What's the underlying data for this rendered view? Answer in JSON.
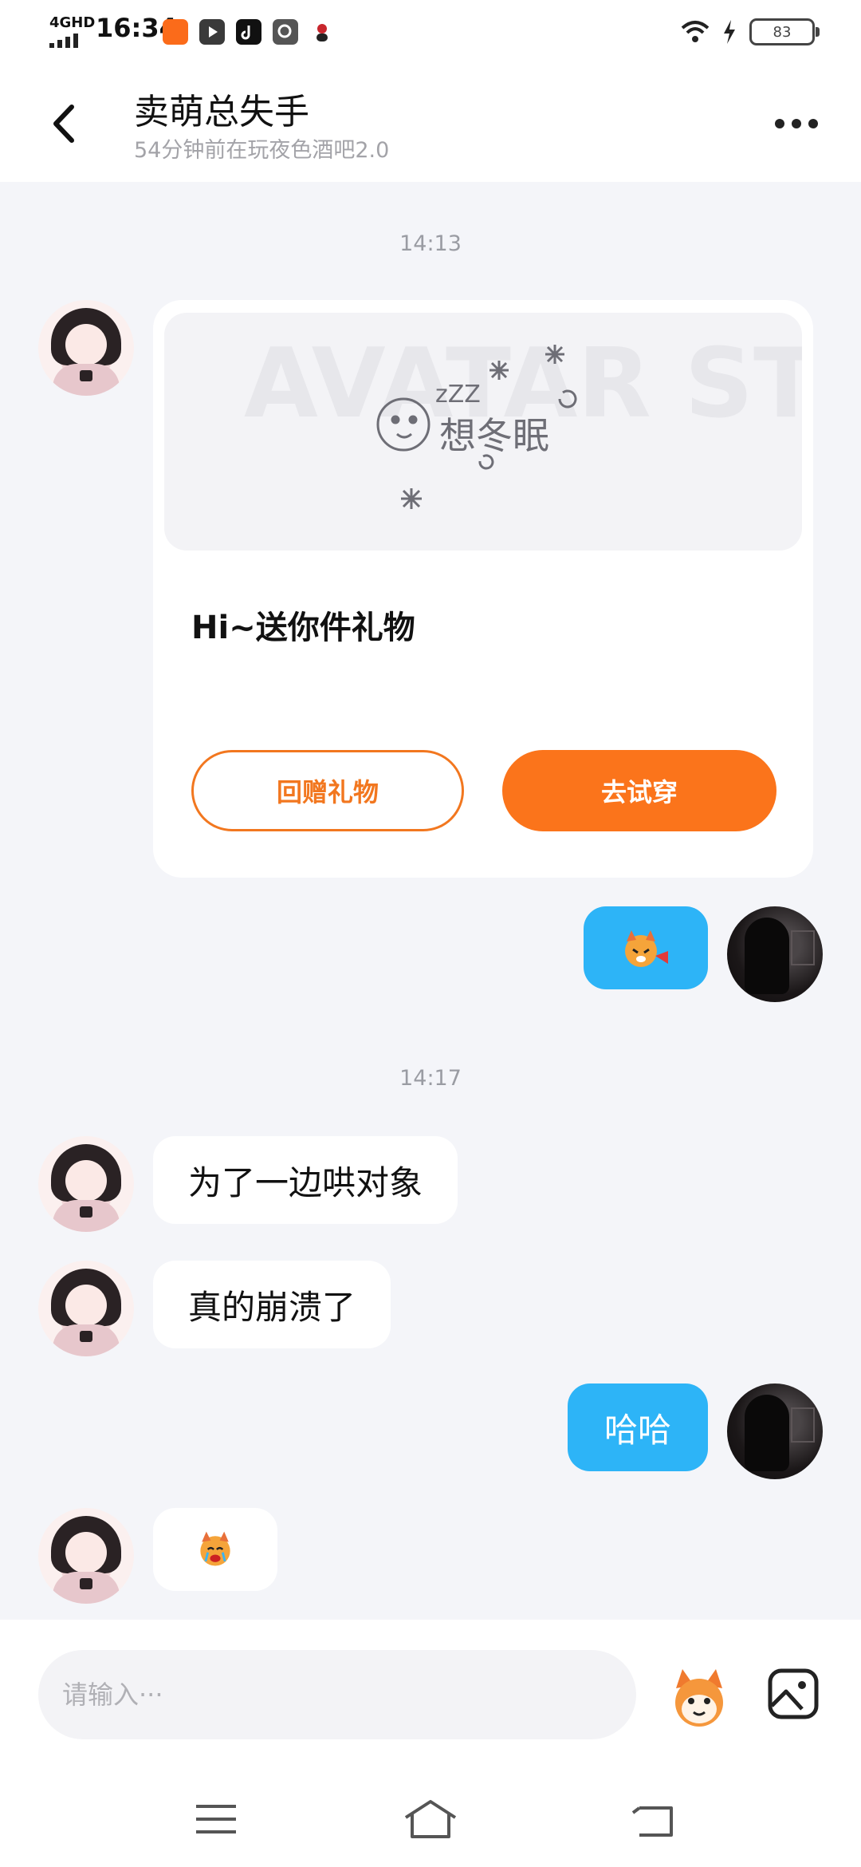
{
  "status_bar": {
    "network": "4GHD",
    "time": "16:34",
    "battery": "83",
    "app_icons": [
      "kuaishou-icon",
      "video-player-icon",
      "tiktok-icon",
      "search-app-icon",
      "avatar-app-icon"
    ]
  },
  "header": {
    "title": "卖萌总失手",
    "subtitle": "54分钟前在玩夜色酒吧2.0"
  },
  "messages": {
    "ts1": "14:13",
    "gift": {
      "image_watermark": "AVATAR STORE",
      "image_text": "想冬眠",
      "image_zzz": "zZZ",
      "text": "Hi~送你件礼物",
      "return_gift": "回赠礼物",
      "try_on": "去试穿"
    },
    "ts2": "14:17",
    "msg1": "为了一边哄对象",
    "msg2": "真的崩溃了",
    "msg3": "哈哈"
  },
  "input": {
    "placeholder": "请输入···"
  },
  "colors": {
    "accent_orange": "#fb741b",
    "bubble_blue": "#2db4f7",
    "background": "#f4f5f9"
  }
}
